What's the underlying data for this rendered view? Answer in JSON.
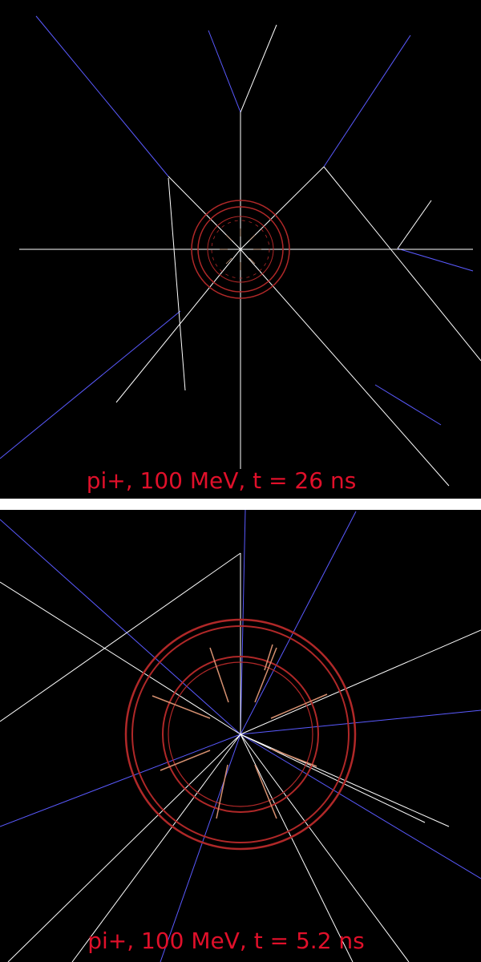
{
  "panels": [
    {
      "caption": "pi+, 100 MeV, t = 26 ns"
    },
    {
      "caption": "pi+, 100 MeV, t = 5.2 ns"
    }
  ],
  "colors": {
    "background": "#000000",
    "separator": "#ffffff",
    "neutral_track": "#ffffff",
    "charged_track": "#5a5aff",
    "detector_ring": "#b02828",
    "caption": "#e0102a"
  }
}
